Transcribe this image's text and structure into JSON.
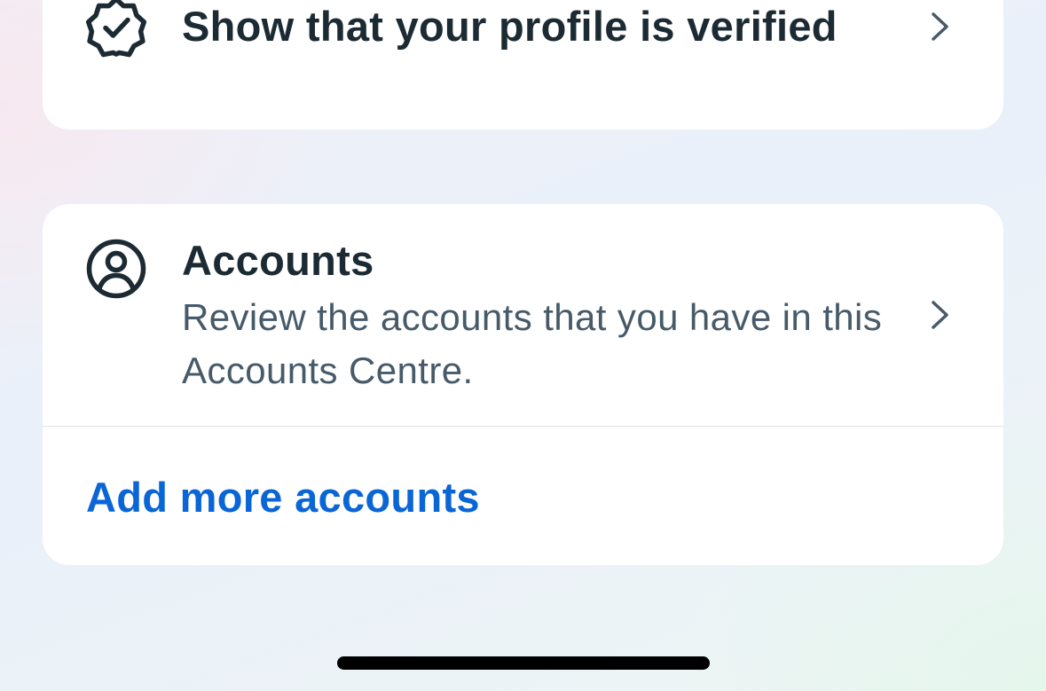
{
  "verification": {
    "title": "Show that your profile is verified",
    "icon": "verified-badge-icon"
  },
  "accounts": {
    "title": "Accounts",
    "subtitle": "Review the accounts that you have in this Accounts Centre.",
    "icon": "account-circle-icon",
    "add_link": "Add more accounts"
  },
  "colors": {
    "text_primary": "#1c2b33",
    "text_secondary": "#465a69",
    "link": "#0a66d6",
    "card_background": "#ffffff"
  }
}
